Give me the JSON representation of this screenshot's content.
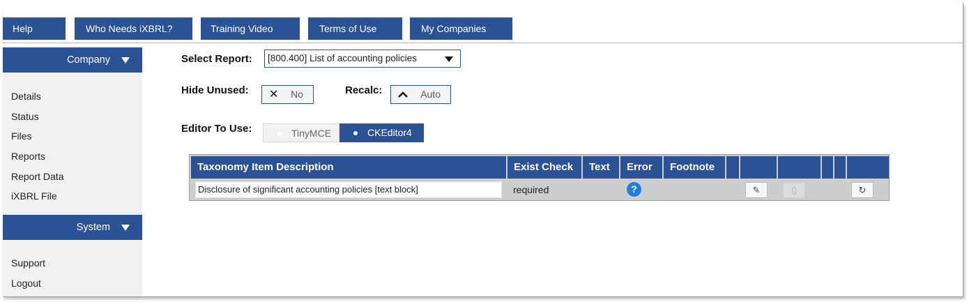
{
  "nav": {
    "items": [
      {
        "label": "Help"
      },
      {
        "label": "Who Needs iXBRL?"
      },
      {
        "label": "Training Video"
      },
      {
        "label": "Terms of Use"
      },
      {
        "label": "My Companies"
      }
    ]
  },
  "sidebar": {
    "company_heading": "Company",
    "company_items": [
      {
        "label": "Details"
      },
      {
        "label": "Status"
      },
      {
        "label": "Files"
      },
      {
        "label": "Reports"
      },
      {
        "label": "Report Data"
      },
      {
        "label": "iXBRL File"
      }
    ],
    "system_heading": "System",
    "system_items": [
      {
        "label": "Support"
      },
      {
        "label": "Logout"
      }
    ]
  },
  "controls": {
    "select_report_label": "Select Report:",
    "select_report_value": "[800.400] List of accounting policies",
    "hide_unused_label": "Hide Unused:",
    "hide_unused_value": "No",
    "recalc_label": "Recalc:",
    "recalc_value": "Auto",
    "editor_label": "Editor To Use:",
    "editor_options": [
      {
        "label": "TinyMCE",
        "selected": false
      },
      {
        "label": "CKEditor4",
        "selected": true
      }
    ]
  },
  "table": {
    "headers": [
      "Taxonomy Item Description",
      "Exist Check",
      "Text",
      "Error",
      "Footnote",
      "",
      "",
      "",
      "",
      "",
      ""
    ],
    "rows": [
      {
        "description": "Disclosure of significant accounting policies [text block]",
        "exist_check": "required",
        "error_icon": "question-circle-icon"
      }
    ]
  },
  "colors": {
    "primary": "#2a5295",
    "error_icon": "#1f7fe0",
    "row_bg": "#cdcdcd"
  }
}
